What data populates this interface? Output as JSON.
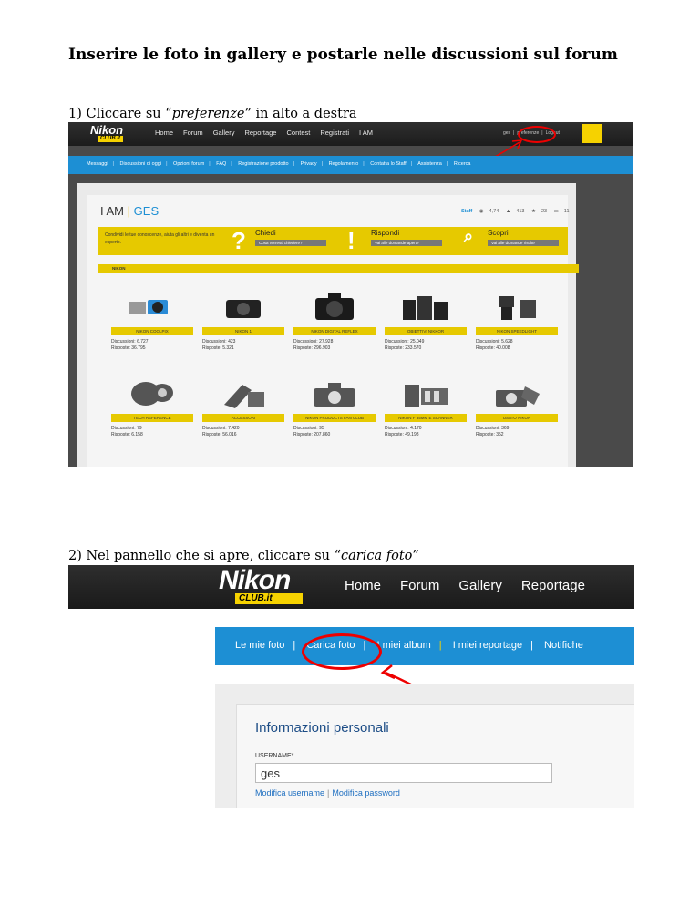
{
  "document": {
    "title": "Inserire le foto in gallery e postarle nelle discussioni sul forum",
    "step1": {
      "prefix": "1) Cliccare su “",
      "emphasis": "preferenze",
      "suffix": "” in alto a destra"
    },
    "step2": {
      "prefix": "2) Nel pannello che si apre,  cliccare su “",
      "emphasis": "carica foto",
      "suffix": "”"
    }
  },
  "shot1": {
    "logo": "Nikon",
    "logo_sub": "CLUB.it",
    "nav": [
      "Home",
      "Forum",
      "Gallery",
      "Reportage",
      "Contest",
      "Registrati",
      "I AM"
    ],
    "user": {
      "name": "ges",
      "preferences": "preferenze",
      "logout": "Logout"
    },
    "subnav": [
      "Messaggi",
      "Discussioni di oggi",
      "Opzioni forum",
      "FAQ",
      "Registrazione prodotto",
      "Privacy",
      "Regolamento",
      "Contatta lo Staff",
      "Assistenza",
      "Ricerca"
    ],
    "iam": {
      "prefix": "I AM",
      "name": "GES"
    },
    "stats": {
      "staff": "Staff",
      "views": "4,74",
      "likes": "413",
      "stars": "23",
      "comments": "11"
    },
    "intro": "Condividi le tue conoscenze, aiuta gli altri e diventa un esperto.",
    "actions": [
      {
        "title": "Chiedi",
        "button": "Cosa vorresti chiedere?"
      },
      {
        "title": "Rispondi",
        "button": "Vai alle domande aperte"
      },
      {
        "title": "Scopri",
        "button": "Vai alle domande risolte"
      }
    ],
    "section": "NIKON",
    "categories": [
      {
        "label": "NIKON COOLPIX",
        "discussioni": "Discussioni: 6.727",
        "risposte": "Risposte: 36.795"
      },
      {
        "label": "NIKON 1",
        "discussioni": "Discussioni: 423",
        "risposte": "Risposte: 5.321"
      },
      {
        "label": "NIKON DIGITAL REFLEX",
        "discussioni": "Discussioni: 27.928",
        "risposte": "Risposte: 296.903"
      },
      {
        "label": "OBIETTIVI NIKKOR",
        "discussioni": "Discussioni: 25.049",
        "risposte": "Risposte: 233.570"
      },
      {
        "label": "NIKON SPEEDLIGHT",
        "discussioni": "Discussioni: 5.628",
        "risposte": "Risposte: 40.008"
      },
      {
        "label": "TECH REFERENCE",
        "discussioni": "Discussioni: 79",
        "risposte": "Risposte: 6.158"
      },
      {
        "label": "ACCESSORI",
        "discussioni": "Discussioni: 7.420",
        "risposte": "Risposte: 56.016"
      },
      {
        "label": "NIKON PRODUCTS FAN CLUB",
        "discussioni": "Discussioni: 95",
        "risposte": "Risposte: 207.860"
      },
      {
        "label": "NIKON F 35MM E SCANNER",
        "discussioni": "Discussioni: 4.170",
        "risposte": "Risposte: 49.198"
      },
      {
        "label": "USATO NIKON",
        "discussioni": "Discussioni: 369",
        "risposte": "Risposte: 352"
      }
    ]
  },
  "shot2": {
    "logo": "Nikon",
    "logo_sub": "CLUB.it",
    "nav": [
      "Home",
      "Forum",
      "Gallery",
      "Reportage"
    ],
    "subnav": [
      "Le mie foto",
      "Carica foto",
      "I miei album",
      "I miei reportage",
      "Notifiche"
    ],
    "heading": "Informazioni personali",
    "username_label": "USERNAME*",
    "username_value": "ges",
    "links": {
      "edit_username": "Modifica username",
      "edit_password": "Modifica password"
    }
  },
  "colors": {
    "accent_blue": "#1d8fd4",
    "brand_yellow": "#e6c900",
    "highlight_red": "#e00000"
  }
}
